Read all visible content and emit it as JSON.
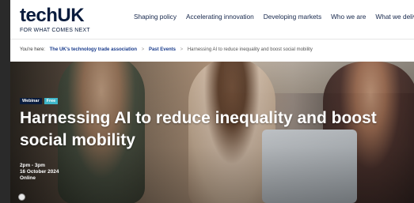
{
  "logo": {
    "word_tech": "tech",
    "word_uk": "UK",
    "tagline": "FOR WHAT COMES NEXT"
  },
  "nav": [
    {
      "label": "Shaping policy"
    },
    {
      "label": "Accelerating innovation"
    },
    {
      "label": "Developing markets"
    },
    {
      "label": "Who we are"
    },
    {
      "label": "What we delive"
    }
  ],
  "breadcrumb": {
    "prefix": "You're here:",
    "items": [
      {
        "label": "The UK's technology trade association"
      },
      {
        "label": "Past Events"
      }
    ],
    "separator": ">",
    "current": "Harnessing AI to reduce inequality and boost social mobility"
  },
  "hero": {
    "tags": [
      {
        "label": "Webinar"
      },
      {
        "label": "Free"
      }
    ],
    "title": "Harnessing AI to reduce inequality and boost social mobility",
    "time": "2pm - 3pm",
    "date": "16 October 2024",
    "location": "Online"
  },
  "colors": {
    "brand_navy": "#0a1c3d",
    "tag_free": "#3fb6c9",
    "link_blue": "#1a3c8c"
  },
  "icons": {
    "cookie": "cookie-settings-icon"
  }
}
